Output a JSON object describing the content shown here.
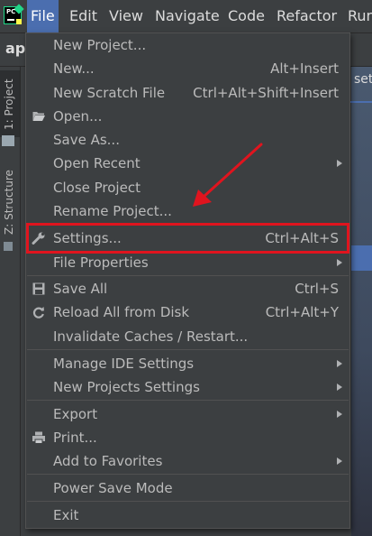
{
  "app_logo_text": "PC",
  "menubar": {
    "items": [
      "File",
      "Edit",
      "View",
      "Navigate",
      "Code",
      "Refactor",
      "Run"
    ],
    "active": "File"
  },
  "project": {
    "name": "app"
  },
  "side_tabs": {
    "project": "1: Project",
    "structure": "Z: Structure"
  },
  "editor_peek_text": "set",
  "file_menu": {
    "items": [
      {
        "label": "New Project...",
        "shortcut": "",
        "icon": "",
        "submenu": false
      },
      {
        "label": "New...",
        "shortcut": "Alt+Insert",
        "icon": "",
        "submenu": false
      },
      {
        "label": "New Scratch File",
        "shortcut": "Ctrl+Alt+Shift+Insert",
        "icon": "",
        "submenu": false
      },
      {
        "label": "Open...",
        "shortcut": "",
        "icon": "folder-icon",
        "submenu": false
      },
      {
        "label": "Save As...",
        "shortcut": "",
        "icon": "",
        "submenu": false
      },
      {
        "label": "Open Recent",
        "shortcut": "",
        "icon": "",
        "submenu": true
      },
      {
        "label": "Close Project",
        "shortcut": "",
        "icon": "",
        "submenu": false
      },
      {
        "label": "Rename Project...",
        "shortcut": "",
        "icon": "",
        "submenu": false
      },
      {
        "label": "Settings...",
        "shortcut": "Ctrl+Alt+S",
        "icon": "wrench-icon",
        "submenu": false
      },
      {
        "label": "File Properties",
        "shortcut": "",
        "icon": "",
        "submenu": true
      },
      {
        "label": "Save All",
        "shortcut": "Ctrl+S",
        "icon": "save-icon",
        "submenu": false
      },
      {
        "label": "Reload All from Disk",
        "shortcut": "Ctrl+Alt+Y",
        "icon": "reload-icon",
        "submenu": false
      },
      {
        "label": "Invalidate Caches / Restart...",
        "shortcut": "",
        "icon": "",
        "submenu": false
      },
      {
        "label": "Manage IDE Settings",
        "shortcut": "",
        "icon": "",
        "submenu": true
      },
      {
        "label": "New Projects Settings",
        "shortcut": "",
        "icon": "",
        "submenu": true
      },
      {
        "label": "Export",
        "shortcut": "",
        "icon": "",
        "submenu": true
      },
      {
        "label": "Print...",
        "shortcut": "",
        "icon": "print-icon",
        "submenu": false
      },
      {
        "label": "Add to Favorites",
        "shortcut": "",
        "icon": "",
        "submenu": true
      },
      {
        "label": "Power Save Mode",
        "shortcut": "",
        "icon": "",
        "submenu": false
      },
      {
        "label": "Exit",
        "shortcut": "",
        "icon": "",
        "submenu": false
      }
    ]
  },
  "annotation": {
    "highlighted_item": "Settings...",
    "color": "#e0141e"
  }
}
